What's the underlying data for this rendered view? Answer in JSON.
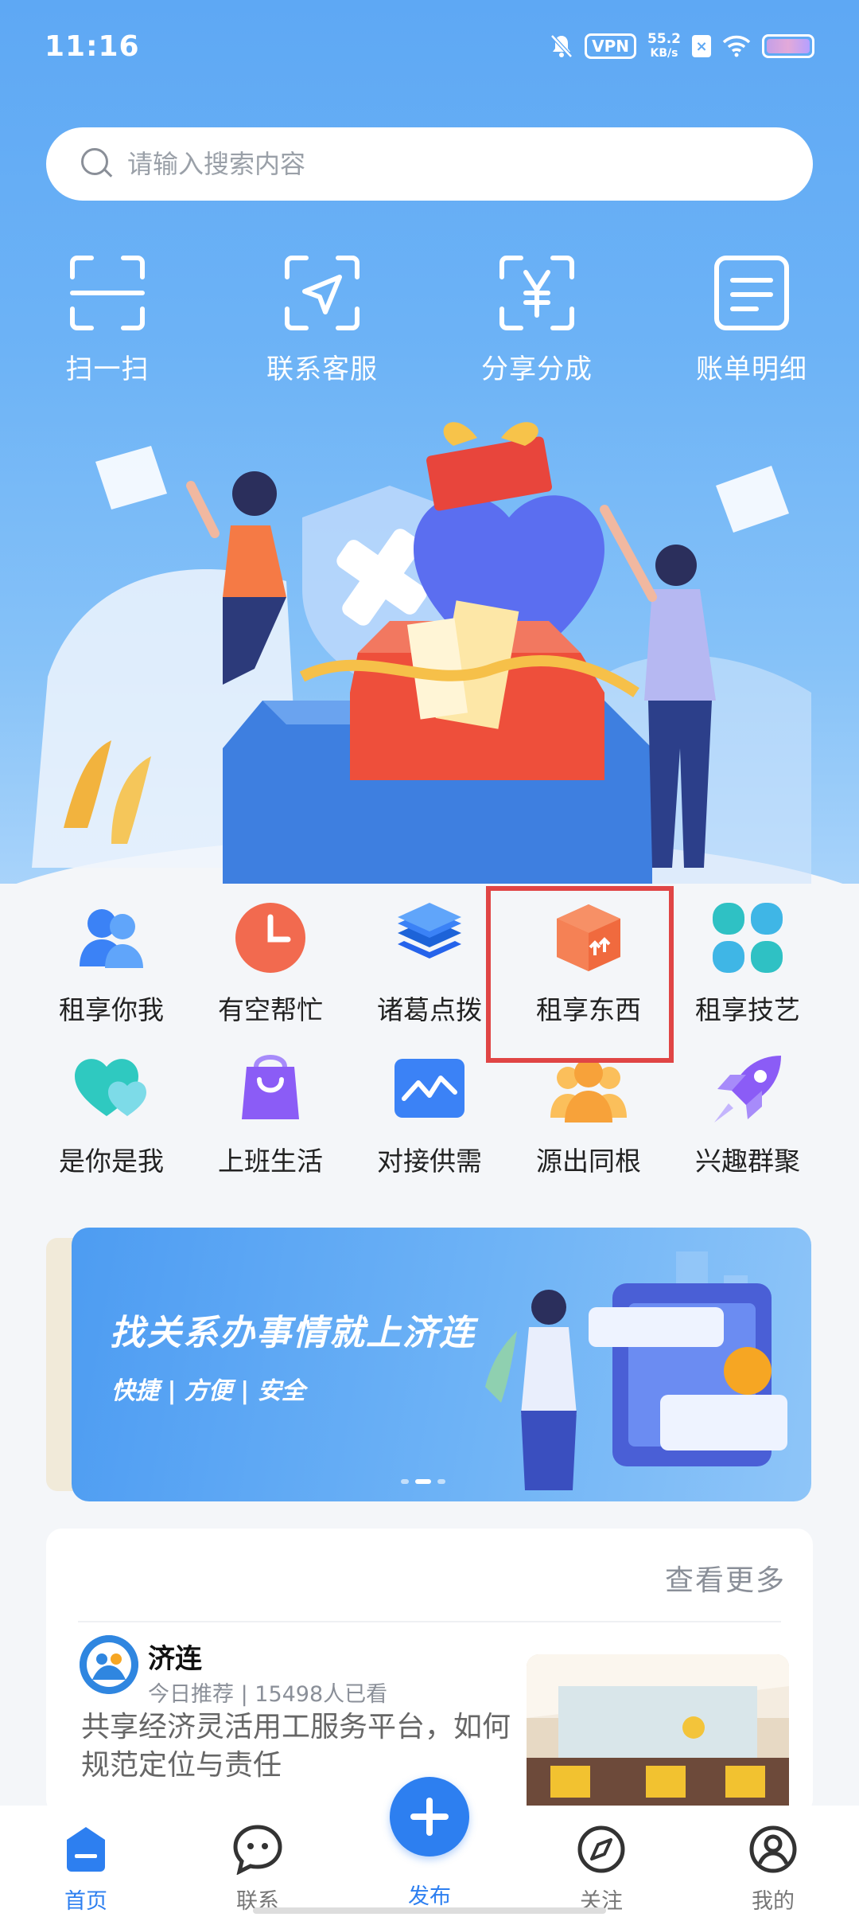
{
  "status_bar": {
    "time": "11:16",
    "vpn": "VPN",
    "speed_value": "55.2",
    "speed_unit": "KB/s"
  },
  "search": {
    "placeholder": "请输入搜索内容"
  },
  "quick_actions": [
    {
      "label": "扫一扫",
      "icon": "scan-icon"
    },
    {
      "label": "联系客服",
      "icon": "send-icon"
    },
    {
      "label": "分享分成",
      "icon": "yuan-icon"
    },
    {
      "label": "账单明细",
      "icon": "document-icon"
    }
  ],
  "categories": [
    {
      "label": "租享你我",
      "icon": "people-icon",
      "color": "#3b82f6"
    },
    {
      "label": "有空帮忙",
      "icon": "clock-icon",
      "color": "#f26a4f"
    },
    {
      "label": "诸葛点拨",
      "icon": "layers-icon",
      "color": "#3b8cf0"
    },
    {
      "label": "租享东西",
      "icon": "box-icon",
      "color": "#f06a3e"
    },
    {
      "label": "租享技艺",
      "icon": "clover-icon",
      "color": "#2fc1c4"
    },
    {
      "label": "是你是我",
      "icon": "hearts-icon",
      "color": "#2fc9c0"
    },
    {
      "label": "上班生活",
      "icon": "bag-icon",
      "color": "#8b5cf6"
    },
    {
      "label": "对接供需",
      "icon": "chart-icon",
      "color": "#3b82f6"
    },
    {
      "label": "源出同根",
      "icon": "group-icon",
      "color": "#f7a23a"
    },
    {
      "label": "兴趣群聚",
      "icon": "rocket-icon",
      "color": "#8b5cf6"
    }
  ],
  "banner": {
    "title": "找关系办事情就上济连",
    "subtitle": "快捷 | 方便 | 安全"
  },
  "news": {
    "more": "查看更多",
    "source": "济连",
    "meta": "今日推荐 | 15498人已看",
    "title": "共享经济灵活用工服务平台，如何规范定位与责任"
  },
  "nav": {
    "home": "首页",
    "contact": "联系",
    "publish": "发布",
    "follow": "关注",
    "mine": "我的"
  },
  "colors": {
    "primary": "#2d7ff0",
    "highlight": "#e04545"
  }
}
